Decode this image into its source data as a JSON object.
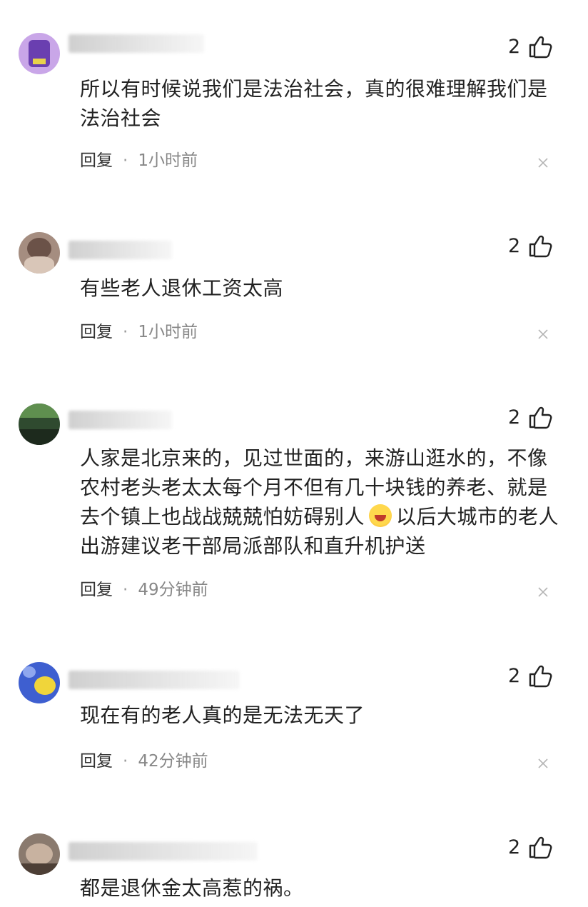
{
  "comments": [
    {
      "like_count": "2",
      "text": "所以有时候说我们是法治社会，真的很难理解我们是法治社会",
      "reply_label": "回复",
      "separator": "·",
      "time": "1小时前",
      "avatar_colors": [
        "#c9a6e8",
        "#6a3fb0",
        "#e8d24a"
      ]
    },
    {
      "like_count": "2",
      "text": "有些老人退休工资太高",
      "reply_label": "回复",
      "separator": "·",
      "time": "1小时前",
      "avatar_colors": [
        "#a58d80",
        "#6b5248",
        "#d9c6b8"
      ]
    },
    {
      "like_count": "2",
      "text_before_emoji": "人家是北京来的，见过世面的，来游山逛水的，不像农村老头老太太每个月不但有几十块钱的养老、就是去个镇上也战战兢兢怕妨碍别人",
      "text_after_emoji": "以后大城市的老人出游建议老干部局派部队和直升机护送",
      "emoji": "laughing-crying-emoji",
      "reply_label": "回复",
      "separator": "·",
      "time": "49分钟前",
      "avatar_colors": [
        "#2f4a2f",
        "#5f8f4f",
        "#1d2a1d"
      ]
    },
    {
      "like_count": "2",
      "text": "现在有的老人真的是无法无天了",
      "reply_label": "回复",
      "separator": "·",
      "time": "42分钟前",
      "avatar_colors": [
        "#3e5fd0",
        "#f0d53a",
        "#8fa7ee"
      ]
    },
    {
      "like_count": "2",
      "text": "都是退休金太高惹的祸。",
      "avatar_colors": [
        "#8a7a6e",
        "#c8b2a0",
        "#4d3f36"
      ]
    }
  ],
  "icons": {
    "like": "thumbs-up-icon",
    "close": "close-icon"
  },
  "colors": {
    "text": "#222222",
    "meta": "#888888",
    "background": "#ffffff"
  }
}
